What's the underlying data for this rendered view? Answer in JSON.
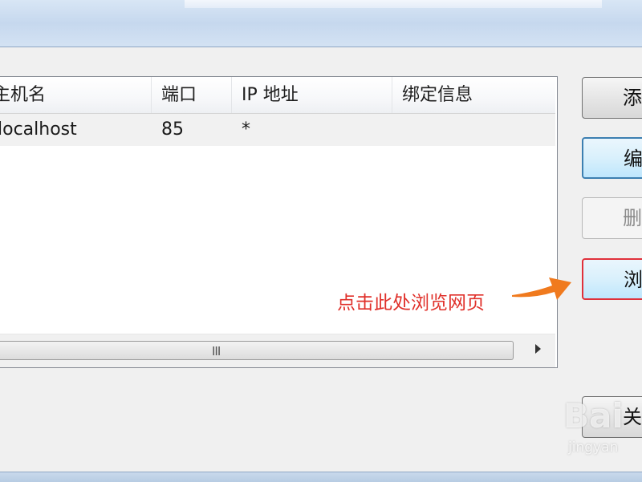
{
  "list": {
    "headers": [
      "主机名",
      "端口",
      "IP 地址",
      "绑定信息"
    ],
    "rows": [
      {
        "host": "localhost",
        "port": "85",
        "ip": "*",
        "binding": ""
      }
    ]
  },
  "scrollbar": {
    "grip": "III"
  },
  "buttons": {
    "add": "添",
    "edit": "编",
    "remove": "删",
    "browse": "浏",
    "close": "关"
  },
  "annotation": "点击此处浏览网页",
  "watermark": {
    "logo": "Bai",
    "sub": "jingyan"
  },
  "colors": {
    "annotation": "#e0302a",
    "arrow": "#f07a1e",
    "highlight_border": "#e0303a"
  }
}
